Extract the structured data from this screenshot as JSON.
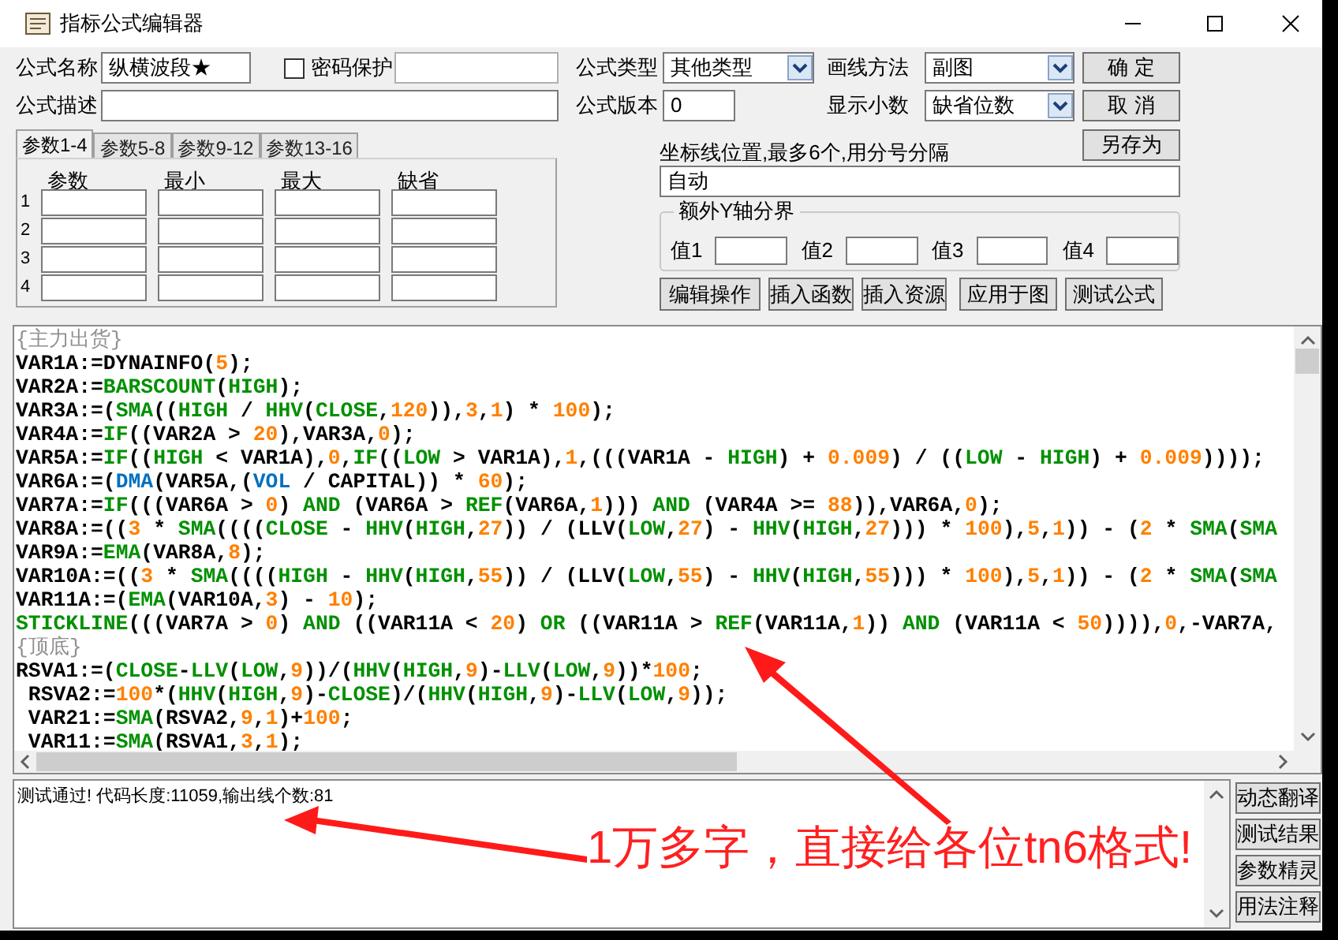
{
  "window": {
    "title": "指标公式编辑器"
  },
  "form": {
    "name": {
      "label": "公式名称",
      "value": "纵横波段★"
    },
    "password": {
      "label": "密码保护",
      "checked": false
    },
    "description": {
      "label": "公式描述"
    },
    "type": {
      "label": "公式类型",
      "value": "其他类型"
    },
    "draw_method": {
      "label": "画线方法",
      "value": "副图"
    },
    "version": {
      "label": "公式版本",
      "value": "0"
    },
    "decimals": {
      "label": "显示小数",
      "value": "缺省位数"
    }
  },
  "side_buttons": [
    "确 定",
    "取 消",
    "另存为"
  ],
  "param_tabs": [
    {
      "label": "参数1-4",
      "selected": true
    },
    {
      "label": "参数5-8",
      "selected": false
    },
    {
      "label": "参数9-12",
      "selected": false
    },
    {
      "label": "参数13-16",
      "selected": false
    }
  ],
  "param_table": {
    "columns": [
      "参数",
      "最小",
      "最大",
      "缺省"
    ],
    "rows": [
      "1",
      "2",
      "3",
      "4"
    ]
  },
  "axis_lines": {
    "label": "坐标线位置,最多6个,用分号分隔",
    "value": "自动"
  },
  "extra_y": {
    "title": "额外Y轴分界",
    "fields": [
      "值1",
      "值2",
      "值3",
      "值4"
    ]
  },
  "action_buttons": [
    "编辑操作",
    "插入函数",
    "插入资源",
    "应用于图",
    "测试公式"
  ],
  "editor": {
    "lines": [
      [
        {
          "kind": "comment",
          "text": "{主力出货}"
        }
      ],
      [
        {
          "kind": "plain",
          "text": "VAR1A:=DYNAINFO("
        },
        {
          "kind": "number",
          "text": "5"
        },
        {
          "kind": "plain",
          "text": ");"
        }
      ],
      [
        {
          "kind": "plain",
          "text": "VAR2A:="
        },
        {
          "kind": "function",
          "text": "BARSCOUNT"
        },
        {
          "kind": "plain",
          "text": "("
        },
        {
          "kind": "function",
          "text": "HIGH"
        },
        {
          "kind": "plain",
          "text": ");"
        }
      ],
      [
        {
          "kind": "plain",
          "text": "VAR3A:=("
        },
        {
          "kind": "function",
          "text": "SMA"
        },
        {
          "kind": "plain",
          "text": "(("
        },
        {
          "kind": "function",
          "text": "HIGH"
        },
        {
          "kind": "plain",
          "text": " / "
        },
        {
          "kind": "function",
          "text": "HHV"
        },
        {
          "kind": "plain",
          "text": "("
        },
        {
          "kind": "function",
          "text": "CLOSE"
        },
        {
          "kind": "plain",
          "text": ","
        },
        {
          "kind": "number",
          "text": "120"
        },
        {
          "kind": "plain",
          "text": ")),"
        },
        {
          "kind": "number",
          "text": "3"
        },
        {
          "kind": "plain",
          "text": ","
        },
        {
          "kind": "number",
          "text": "1"
        },
        {
          "kind": "plain",
          "text": ") * "
        },
        {
          "kind": "number",
          "text": "100"
        },
        {
          "kind": "plain",
          "text": ");"
        }
      ],
      [
        {
          "kind": "plain",
          "text": "VAR4A:="
        },
        {
          "kind": "function",
          "text": "IF"
        },
        {
          "kind": "plain",
          "text": "((VAR2A > "
        },
        {
          "kind": "number",
          "text": "20"
        },
        {
          "kind": "plain",
          "text": "),VAR3A,"
        },
        {
          "kind": "number",
          "text": "0"
        },
        {
          "kind": "plain",
          "text": ");"
        }
      ],
      [
        {
          "kind": "plain",
          "text": "VAR5A:="
        },
        {
          "kind": "function",
          "text": "IF"
        },
        {
          "kind": "plain",
          "text": "(("
        },
        {
          "kind": "function",
          "text": "HIGH"
        },
        {
          "kind": "plain",
          "text": " < VAR1A),"
        },
        {
          "kind": "number",
          "text": "0"
        },
        {
          "kind": "plain",
          "text": ","
        },
        {
          "kind": "function",
          "text": "IF"
        },
        {
          "kind": "plain",
          "text": "(("
        },
        {
          "kind": "function",
          "text": "LOW"
        },
        {
          "kind": "plain",
          "text": " > VAR1A),"
        },
        {
          "kind": "number",
          "text": "1"
        },
        {
          "kind": "plain",
          "text": ",(((VAR1A - "
        },
        {
          "kind": "function",
          "text": "HIGH"
        },
        {
          "kind": "plain",
          "text": ") + "
        },
        {
          "kind": "number",
          "text": "0.009"
        },
        {
          "kind": "plain",
          "text": ") / (("
        },
        {
          "kind": "function",
          "text": "LOW"
        },
        {
          "kind": "plain",
          "text": " - "
        },
        {
          "kind": "function",
          "text": "HIGH"
        },
        {
          "kind": "plain",
          "text": ") + "
        },
        {
          "kind": "number",
          "text": "0.009"
        },
        {
          "kind": "plain",
          "text": "))));"
        }
      ],
      [
        {
          "kind": "plain",
          "text": "VAR6A:=("
        },
        {
          "kind": "system",
          "text": "DMA"
        },
        {
          "kind": "plain",
          "text": "(VAR5A,("
        },
        {
          "kind": "system",
          "text": "VOL"
        },
        {
          "kind": "plain",
          "text": " / CAPITAL)) * "
        },
        {
          "kind": "number",
          "text": "60"
        },
        {
          "kind": "plain",
          "text": ");"
        }
      ],
      [
        {
          "kind": "plain",
          "text": "VAR7A:="
        },
        {
          "kind": "function",
          "text": "IF"
        },
        {
          "kind": "plain",
          "text": "(((VAR6A > "
        },
        {
          "kind": "number",
          "text": "0"
        },
        {
          "kind": "plain",
          "text": ") "
        },
        {
          "kind": "function",
          "text": "AND"
        },
        {
          "kind": "plain",
          "text": " (VAR6A > "
        },
        {
          "kind": "function",
          "text": "REF"
        },
        {
          "kind": "plain",
          "text": "(VAR6A,"
        },
        {
          "kind": "number",
          "text": "1"
        },
        {
          "kind": "plain",
          "text": "))) "
        },
        {
          "kind": "function",
          "text": "AND"
        },
        {
          "kind": "plain",
          "text": " (VAR4A >= "
        },
        {
          "kind": "number",
          "text": "88"
        },
        {
          "kind": "plain",
          "text": ")),VAR6A,"
        },
        {
          "kind": "number",
          "text": "0"
        },
        {
          "kind": "plain",
          "text": ");"
        }
      ],
      [
        {
          "kind": "plain",
          "text": "VAR8A:=(("
        },
        {
          "kind": "number",
          "text": "3"
        },
        {
          "kind": "plain",
          "text": " * "
        },
        {
          "kind": "function",
          "text": "SMA"
        },
        {
          "kind": "plain",
          "text": "(((("
        },
        {
          "kind": "function",
          "text": "CLOSE"
        },
        {
          "kind": "plain",
          "text": " - "
        },
        {
          "kind": "function",
          "text": "HHV"
        },
        {
          "kind": "plain",
          "text": "("
        },
        {
          "kind": "function",
          "text": "HIGH"
        },
        {
          "kind": "plain",
          "text": ","
        },
        {
          "kind": "number",
          "text": "27"
        },
        {
          "kind": "plain",
          "text": ")) / (LLV("
        },
        {
          "kind": "function",
          "text": "LOW"
        },
        {
          "kind": "plain",
          "text": ","
        },
        {
          "kind": "number",
          "text": "27"
        },
        {
          "kind": "plain",
          "text": ") - "
        },
        {
          "kind": "function",
          "text": "HHV"
        },
        {
          "kind": "plain",
          "text": "("
        },
        {
          "kind": "function",
          "text": "HIGH"
        },
        {
          "kind": "plain",
          "text": ","
        },
        {
          "kind": "number",
          "text": "27"
        },
        {
          "kind": "plain",
          "text": "))) * "
        },
        {
          "kind": "number",
          "text": "100"
        },
        {
          "kind": "plain",
          "text": "),"
        },
        {
          "kind": "number",
          "text": "5"
        },
        {
          "kind": "plain",
          "text": ","
        },
        {
          "kind": "number",
          "text": "1"
        },
        {
          "kind": "plain",
          "text": ")) - ("
        },
        {
          "kind": "number",
          "text": "2"
        },
        {
          "kind": "plain",
          "text": " * "
        },
        {
          "kind": "function",
          "text": "SMA"
        },
        {
          "kind": "plain",
          "text": "("
        },
        {
          "kind": "function",
          "text": "SMA"
        }
      ],
      [
        {
          "kind": "plain",
          "text": "VAR9A:="
        },
        {
          "kind": "function",
          "text": "EMA"
        },
        {
          "kind": "plain",
          "text": "(VAR8A,"
        },
        {
          "kind": "number",
          "text": "8"
        },
        {
          "kind": "plain",
          "text": ");"
        }
      ],
      [
        {
          "kind": "plain",
          "text": "VAR10A:=(("
        },
        {
          "kind": "number",
          "text": "3"
        },
        {
          "kind": "plain",
          "text": " * "
        },
        {
          "kind": "function",
          "text": "SMA"
        },
        {
          "kind": "plain",
          "text": "(((("
        },
        {
          "kind": "function",
          "text": "HIGH"
        },
        {
          "kind": "plain",
          "text": " - "
        },
        {
          "kind": "function",
          "text": "HHV"
        },
        {
          "kind": "plain",
          "text": "("
        },
        {
          "kind": "function",
          "text": "HIGH"
        },
        {
          "kind": "plain",
          "text": ","
        },
        {
          "kind": "number",
          "text": "55"
        },
        {
          "kind": "plain",
          "text": ")) / (LLV("
        },
        {
          "kind": "function",
          "text": "LOW"
        },
        {
          "kind": "plain",
          "text": ","
        },
        {
          "kind": "number",
          "text": "55"
        },
        {
          "kind": "plain",
          "text": ") - "
        },
        {
          "kind": "function",
          "text": "HHV"
        },
        {
          "kind": "plain",
          "text": "("
        },
        {
          "kind": "function",
          "text": "HIGH"
        },
        {
          "kind": "plain",
          "text": ","
        },
        {
          "kind": "number",
          "text": "55"
        },
        {
          "kind": "plain",
          "text": "))) * "
        },
        {
          "kind": "number",
          "text": "100"
        },
        {
          "kind": "plain",
          "text": "),"
        },
        {
          "kind": "number",
          "text": "5"
        },
        {
          "kind": "plain",
          "text": ","
        },
        {
          "kind": "number",
          "text": "1"
        },
        {
          "kind": "plain",
          "text": ")) - ("
        },
        {
          "kind": "number",
          "text": "2"
        },
        {
          "kind": "plain",
          "text": " * "
        },
        {
          "kind": "function",
          "text": "SMA"
        },
        {
          "kind": "plain",
          "text": "("
        },
        {
          "kind": "function",
          "text": "SMA"
        }
      ],
      [
        {
          "kind": "plain",
          "text": "VAR11A:=("
        },
        {
          "kind": "function",
          "text": "EMA"
        },
        {
          "kind": "plain",
          "text": "(VAR10A,"
        },
        {
          "kind": "number",
          "text": "3"
        },
        {
          "kind": "plain",
          "text": ") - "
        },
        {
          "kind": "number",
          "text": "10"
        },
        {
          "kind": "plain",
          "text": ");"
        }
      ],
      [
        {
          "kind": "function",
          "text": "STICKLINE"
        },
        {
          "kind": "plain",
          "text": "(((VAR7A > "
        },
        {
          "kind": "number",
          "text": "0"
        },
        {
          "kind": "plain",
          "text": ") "
        },
        {
          "kind": "function",
          "text": "AND"
        },
        {
          "kind": "plain",
          "text": " ((VAR11A < "
        },
        {
          "kind": "number",
          "text": "20"
        },
        {
          "kind": "plain",
          "text": ") "
        },
        {
          "kind": "function",
          "text": "OR"
        },
        {
          "kind": "plain",
          "text": " ((VAR11A > "
        },
        {
          "kind": "function",
          "text": "REF"
        },
        {
          "kind": "plain",
          "text": "(VAR11A,"
        },
        {
          "kind": "number",
          "text": "1"
        },
        {
          "kind": "plain",
          "text": ")) "
        },
        {
          "kind": "function",
          "text": "AND"
        },
        {
          "kind": "plain",
          "text": " (VAR11A < "
        },
        {
          "kind": "number",
          "text": "50"
        },
        {
          "kind": "plain",
          "text": ")))),"
        },
        {
          "kind": "number",
          "text": "0"
        },
        {
          "kind": "plain",
          "text": ",-VAR7A,"
        }
      ],
      [
        {
          "kind": "comment",
          "text": "{顶底}"
        }
      ],
      [
        {
          "kind": "plain",
          "text": "RSVA1:=("
        },
        {
          "kind": "function",
          "text": "CLOSE"
        },
        {
          "kind": "plain",
          "text": "-"
        },
        {
          "kind": "function",
          "text": "LLV"
        },
        {
          "kind": "plain",
          "text": "("
        },
        {
          "kind": "function",
          "text": "LOW"
        },
        {
          "kind": "plain",
          "text": ","
        },
        {
          "kind": "number",
          "text": "9"
        },
        {
          "kind": "plain",
          "text": "))/("
        },
        {
          "kind": "function",
          "text": "HHV"
        },
        {
          "kind": "plain",
          "text": "("
        },
        {
          "kind": "function",
          "text": "HIGH"
        },
        {
          "kind": "plain",
          "text": ","
        },
        {
          "kind": "number",
          "text": "9"
        },
        {
          "kind": "plain",
          "text": ")-"
        },
        {
          "kind": "function",
          "text": "LLV"
        },
        {
          "kind": "plain",
          "text": "("
        },
        {
          "kind": "function",
          "text": "LOW"
        },
        {
          "kind": "plain",
          "text": ","
        },
        {
          "kind": "number",
          "text": "9"
        },
        {
          "kind": "plain",
          "text": "))*"
        },
        {
          "kind": "number",
          "text": "100"
        },
        {
          "kind": "plain",
          "text": ";"
        }
      ],
      [
        {
          "kind": "plain",
          "text": " RSVA2:="
        },
        {
          "kind": "number",
          "text": "100"
        },
        {
          "kind": "plain",
          "text": "*("
        },
        {
          "kind": "function",
          "text": "HHV"
        },
        {
          "kind": "plain",
          "text": "("
        },
        {
          "kind": "function",
          "text": "HIGH"
        },
        {
          "kind": "plain",
          "text": ","
        },
        {
          "kind": "number",
          "text": "9"
        },
        {
          "kind": "plain",
          "text": ")-"
        },
        {
          "kind": "function",
          "text": "CLOSE"
        },
        {
          "kind": "plain",
          "text": ")/("
        },
        {
          "kind": "function",
          "text": "HHV"
        },
        {
          "kind": "plain",
          "text": "("
        },
        {
          "kind": "function",
          "text": "HIGH"
        },
        {
          "kind": "plain",
          "text": ","
        },
        {
          "kind": "number",
          "text": "9"
        },
        {
          "kind": "plain",
          "text": ")-"
        },
        {
          "kind": "function",
          "text": "LLV"
        },
        {
          "kind": "plain",
          "text": "("
        },
        {
          "kind": "function",
          "text": "LOW"
        },
        {
          "kind": "plain",
          "text": ","
        },
        {
          "kind": "number",
          "text": "9"
        },
        {
          "kind": "plain",
          "text": "));"
        }
      ],
      [
        {
          "kind": "plain",
          "text": " VAR21:="
        },
        {
          "kind": "function",
          "text": "SMA"
        },
        {
          "kind": "plain",
          "text": "(RSVA2,"
        },
        {
          "kind": "number",
          "text": "9"
        },
        {
          "kind": "plain",
          "text": ","
        },
        {
          "kind": "number",
          "text": "1"
        },
        {
          "kind": "plain",
          "text": ")+"
        },
        {
          "kind": "number",
          "text": "100"
        },
        {
          "kind": "plain",
          "text": ";"
        }
      ],
      [
        {
          "kind": "plain",
          "text": " VAR11:="
        },
        {
          "kind": "function",
          "text": "SMA"
        },
        {
          "kind": "plain",
          "text": "(RSVA1,"
        },
        {
          "kind": "number",
          "text": "3"
        },
        {
          "kind": "plain",
          "text": ","
        },
        {
          "kind": "number",
          "text": "1"
        },
        {
          "kind": "plain",
          "text": ");"
        }
      ]
    ]
  },
  "output": {
    "text": "测试通过! 代码长度:11059,输出线个数:81"
  },
  "output_buttons": [
    "动态翻译",
    "测试结果",
    "参数精灵",
    "用法注释"
  ],
  "annotation": {
    "text": "1万多字，直接给各位tn6格式!"
  }
}
